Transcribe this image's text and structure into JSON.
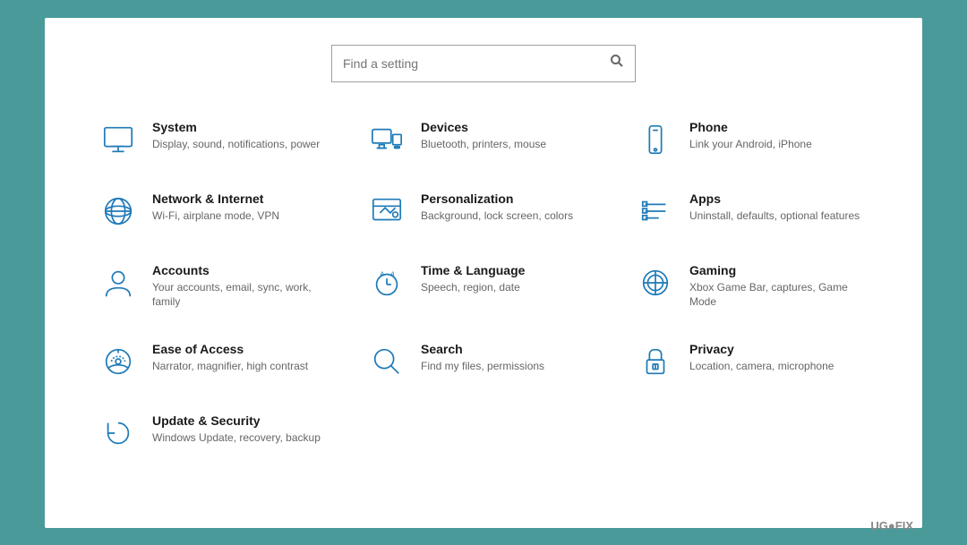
{
  "search": {
    "placeholder": "Find a setting"
  },
  "items": [
    {
      "id": "system",
      "title": "System",
      "subtitle": "Display, sound, notifications, power",
      "icon": "system"
    },
    {
      "id": "devices",
      "title": "Devices",
      "subtitle": "Bluetooth, printers, mouse",
      "icon": "devices"
    },
    {
      "id": "phone",
      "title": "Phone",
      "subtitle": "Link your Android, iPhone",
      "icon": "phone"
    },
    {
      "id": "network",
      "title": "Network & Internet",
      "subtitle": "Wi-Fi, airplane mode, VPN",
      "icon": "network"
    },
    {
      "id": "personalization",
      "title": "Personalization",
      "subtitle": "Background, lock screen, colors",
      "icon": "personalization"
    },
    {
      "id": "apps",
      "title": "Apps",
      "subtitle": "Uninstall, defaults, optional features",
      "icon": "apps"
    },
    {
      "id": "accounts",
      "title": "Accounts",
      "subtitle": "Your accounts, email, sync, work, family",
      "icon": "accounts"
    },
    {
      "id": "time",
      "title": "Time & Language",
      "subtitle": "Speech, region, date",
      "icon": "time"
    },
    {
      "id": "gaming",
      "title": "Gaming",
      "subtitle": "Xbox Game Bar, captures, Game Mode",
      "icon": "gaming"
    },
    {
      "id": "ease",
      "title": "Ease of Access",
      "subtitle": "Narrator, magnifier, high contrast",
      "icon": "ease"
    },
    {
      "id": "search",
      "title": "Search",
      "subtitle": "Find my files, permissions",
      "icon": "search"
    },
    {
      "id": "privacy",
      "title": "Privacy",
      "subtitle": "Location, camera, microphone",
      "icon": "privacy"
    },
    {
      "id": "update",
      "title": "Update & Security",
      "subtitle": "Windows Update, recovery, backup",
      "icon": "update"
    }
  ],
  "watermark": "UG●FIX"
}
